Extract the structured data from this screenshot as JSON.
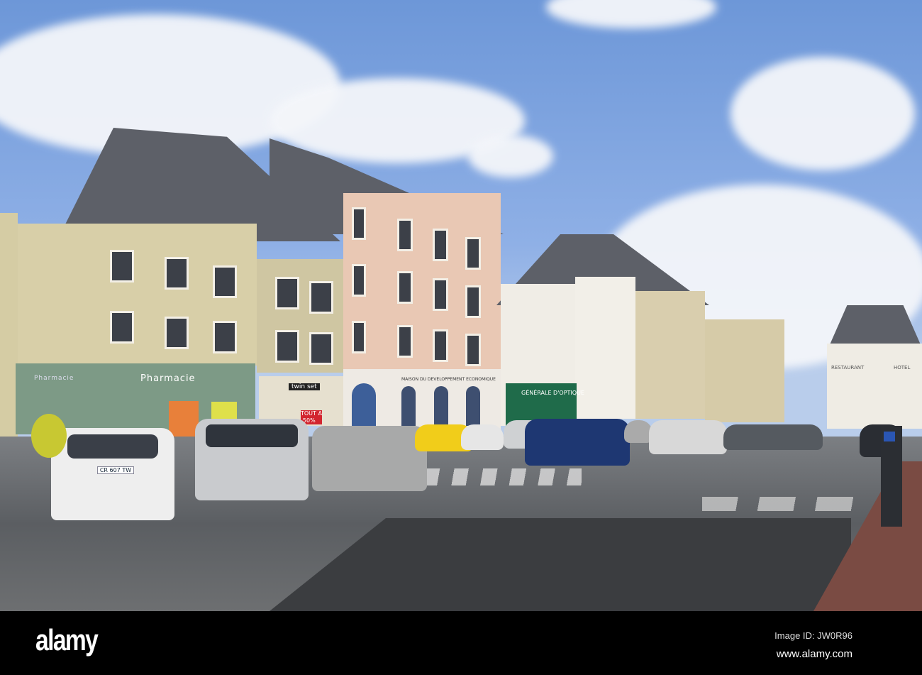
{
  "photo": {
    "subject": "Town square with parked cars and shopfronts",
    "signs": {
      "pharmacie_main": "Pharmacie",
      "pharmacie_side": "Pharmacie",
      "twinset": "twin set",
      "sale": "TOUT A -50%",
      "maison": "MAISON DU DEVELOPPEMENT ECONOMIQUE",
      "optique": "GÉNÉRALE D'OPTIQUE",
      "restaurant": "RESTAURANT",
      "hotel": "HOTEL"
    },
    "plates": [
      "CR 607 TW"
    ]
  },
  "watermark": {
    "logo": "alamy",
    "image_id": "Image ID: JW0R96",
    "url": "www.alamy.com"
  },
  "colors": {
    "sky": "#7ea3e0",
    "pharmacy_green": "#7d9a86",
    "road": "#5f6266"
  }
}
